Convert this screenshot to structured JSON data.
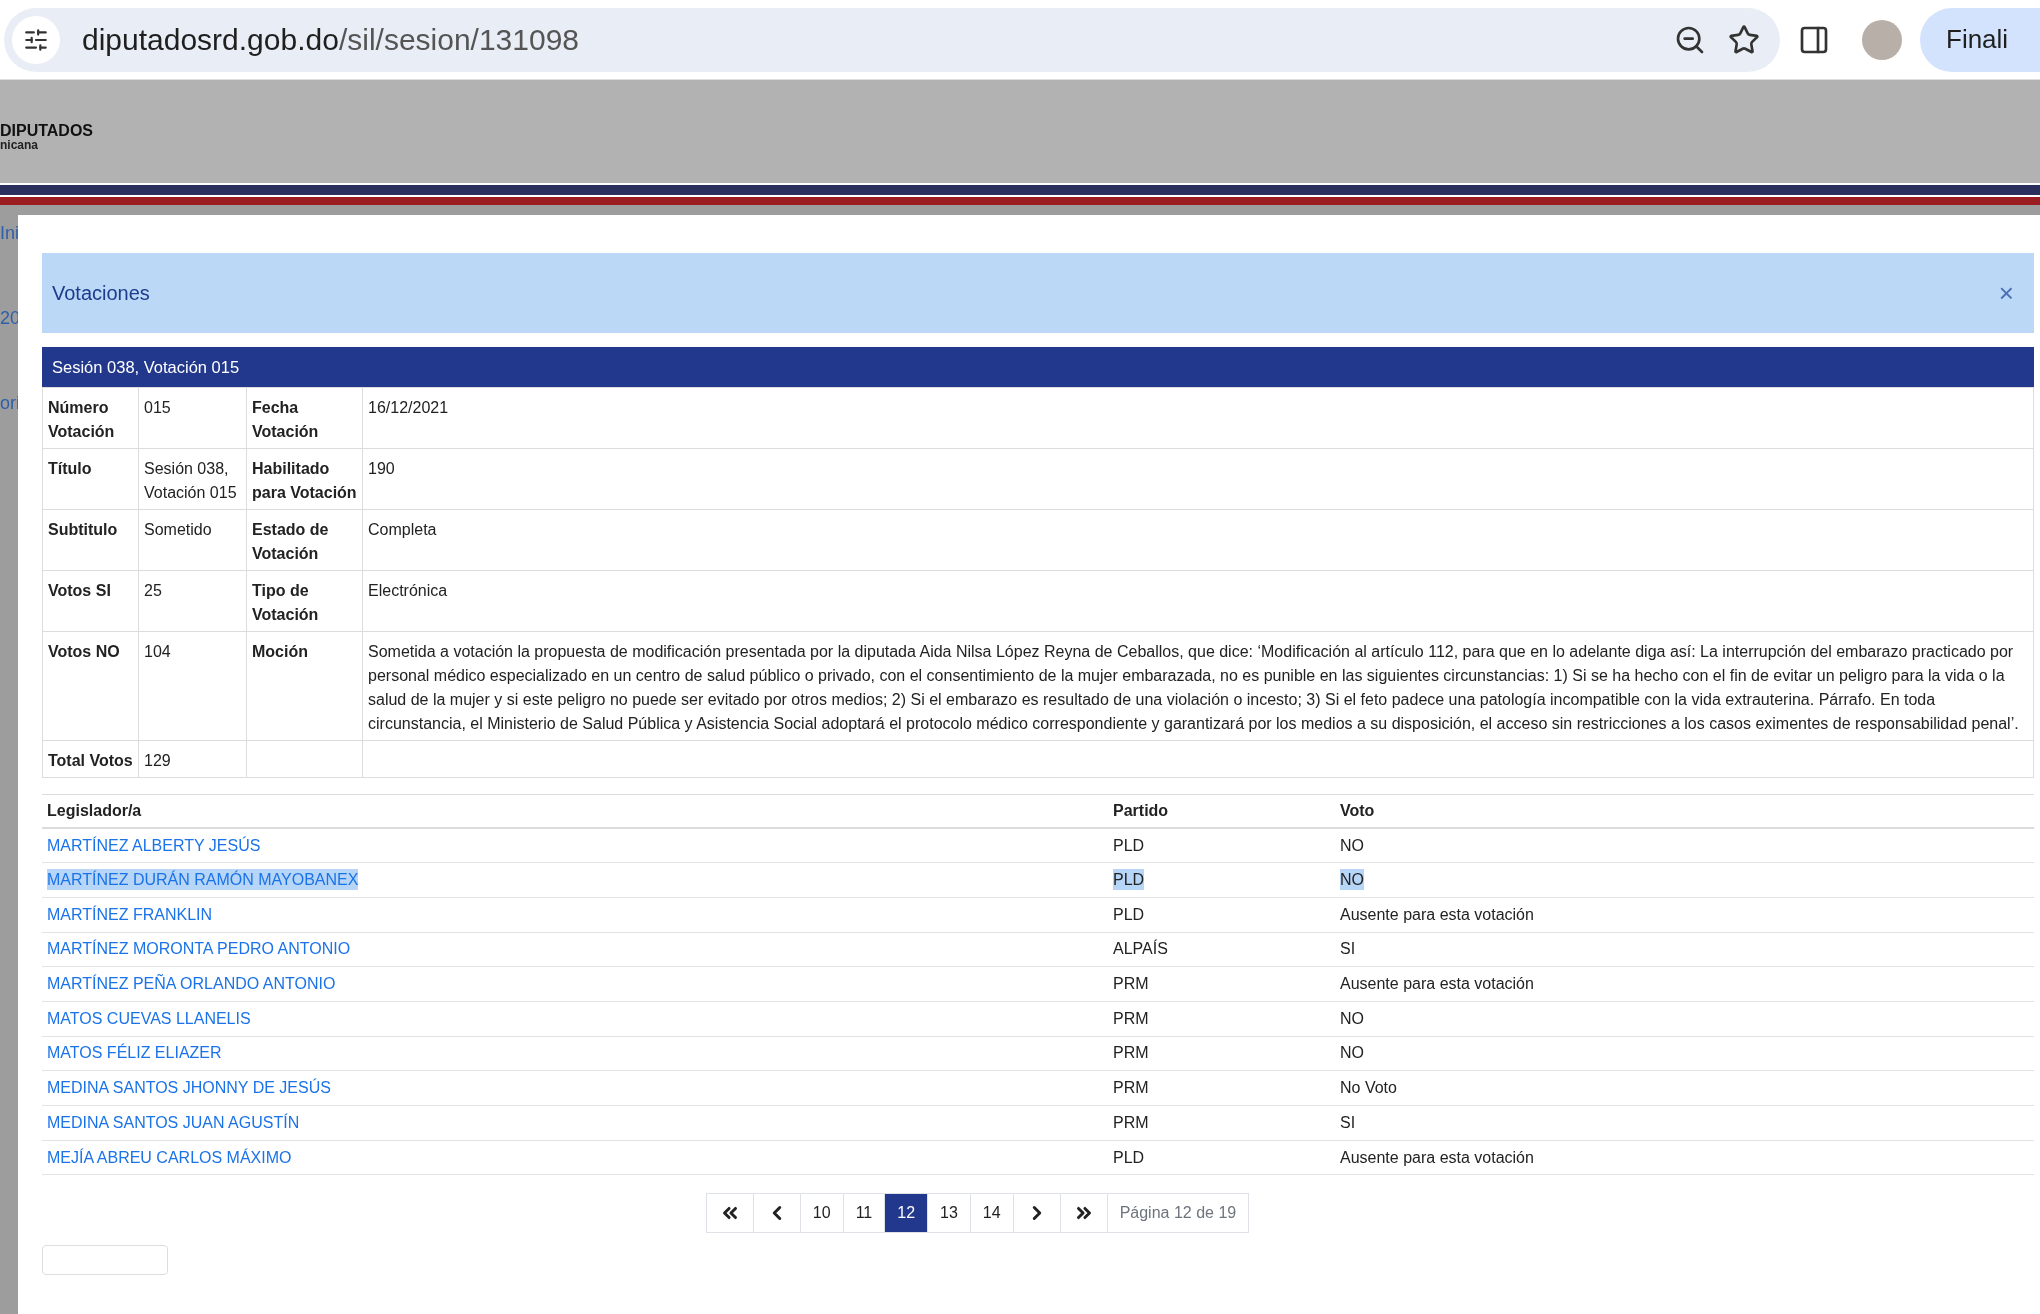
{
  "browser": {
    "url_host": "diputadosrd.gob.do",
    "url_path": "/sil/sesion/131098",
    "action_label": "Finali"
  },
  "site_header": {
    "title": "DIPUTADOS",
    "subtitle": "nicana"
  },
  "backdrop_fragments": [
    "Ini",
    "20",
    "ori"
  ],
  "modal": {
    "title": "Votaciones",
    "close": "×"
  },
  "session_title": "Sesión 038, Votación 015",
  "details": [
    {
      "pairs": [
        {
          "label": "Número Votación",
          "value": "015"
        },
        {
          "label": "Fecha Votación",
          "value": "16/12/2021"
        }
      ]
    },
    {
      "pairs": [
        {
          "label": "Título",
          "value": "Sesión 038, Votación 015"
        },
        {
          "label": "Habilitado para Votación",
          "value": "190"
        }
      ]
    },
    {
      "pairs": [
        {
          "label": "Subtitulo",
          "value": "Sometido"
        },
        {
          "label": "Estado de Votación",
          "value": "Completa"
        }
      ]
    },
    {
      "pairs": [
        {
          "label": "Votos SI",
          "value": "25"
        },
        {
          "label": "Tipo de Votación",
          "value": "Electrónica"
        }
      ]
    },
    {
      "pairs": [
        {
          "label": "Votos NO",
          "value": "104"
        },
        {
          "label": "Moción",
          "value": "Sometida a votación la propuesta de modificación presentada por la diputada Aida Nilsa López Reyna de Ceballos, que dice: ‘Modificación al artículo 112, para que en lo adelante diga así: La interrupción del embarazo practicado por personal médico especializado en un centro de salud público o privado, con el consentimiento de la mujer embarazada, no es punible en las siguientes circunstancias: 1) Si se ha hecho con el fin de evitar un peligro para la vida o la salud de la mujer y si este peligro no puede ser evitado por otros medios; 2) Si el embarazo es resultado de una violación o incesto; 3) Si el feto padece una patología incompatible con la vida extrauterina. Párrafo. En toda circunstancia, el Ministerio de Salud Pública y Asistencia Social adoptará el protocolo médico correspondiente y garantizará por los medios a su disposición, el acceso sin restricciones a los casos eximentes de responsabilidad penal’."
        }
      ]
    },
    {
      "pairs": [
        {
          "label": "Total Votos",
          "value": "129"
        }
      ]
    }
  ],
  "legislators": {
    "columns": [
      "Legislador/a",
      "Partido",
      "Voto"
    ],
    "rows": [
      {
        "name": "MARTÍNEZ ALBERTY JESÚS",
        "party": "PLD",
        "vote": "NO",
        "highlighted": false
      },
      {
        "name": "MARTÍNEZ DURÁN RAMÓN MAYOBANEX",
        "party": "PLD",
        "vote": "NO",
        "highlighted": true
      },
      {
        "name": "MARTÍNEZ FRANKLIN",
        "party": "PLD",
        "vote": "Ausente para esta votación",
        "highlighted": false
      },
      {
        "name": "MARTÍNEZ MORONTA PEDRO ANTONIO",
        "party": "ALPAÍS",
        "vote": "SI",
        "highlighted": false
      },
      {
        "name": "MARTÍNEZ PEÑA ORLANDO ANTONIO",
        "party": "PRM",
        "vote": "Ausente para esta votación",
        "highlighted": false
      },
      {
        "name": "MATOS CUEVAS LLANELIS",
        "party": "PRM",
        "vote": "NO",
        "highlighted": false
      },
      {
        "name": "MATOS FÉLIZ ELIAZER",
        "party": "PRM",
        "vote": "NO",
        "highlighted": false
      },
      {
        "name": "MEDINA SANTOS JHONNY DE JESÚS",
        "party": "PRM",
        "vote": "No Voto",
        "highlighted": false
      },
      {
        "name": "MEDINA SANTOS JUAN AGUSTÍN",
        "party": "PRM",
        "vote": "SI",
        "highlighted": false
      },
      {
        "name": "MEJÍA ABREU CARLOS MÁXIMO",
        "party": "PLD",
        "vote": "Ausente para esta votación",
        "highlighted": false
      }
    ]
  },
  "pagination": {
    "items": [
      {
        "kind": "first"
      },
      {
        "kind": "prev"
      },
      {
        "kind": "page",
        "label": "10",
        "selected": false
      },
      {
        "kind": "page",
        "label": "11",
        "selected": false
      },
      {
        "kind": "page",
        "label": "12",
        "selected": true
      },
      {
        "kind": "page",
        "label": "13",
        "selected": false
      },
      {
        "kind": "page",
        "label": "14",
        "selected": false
      },
      {
        "kind": "next"
      },
      {
        "kind": "last"
      }
    ],
    "info": "Página 12 de 19"
  }
}
